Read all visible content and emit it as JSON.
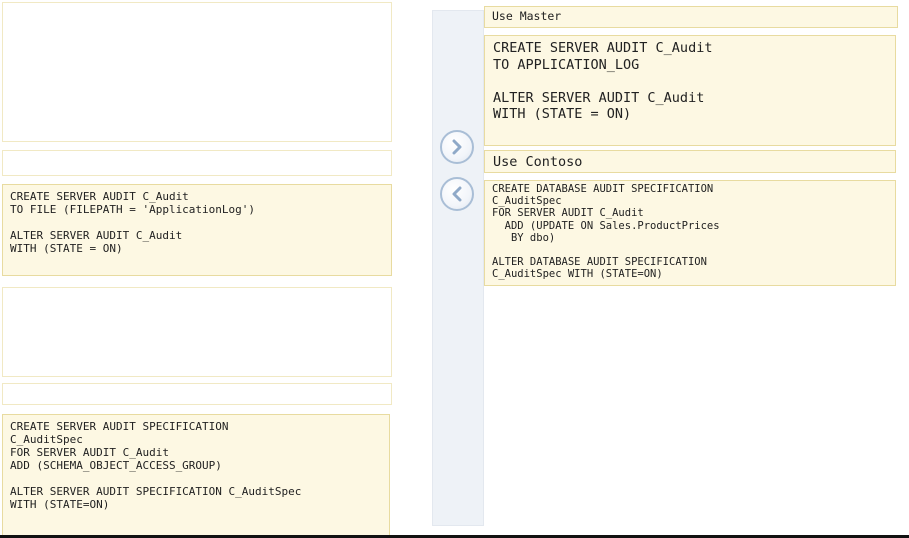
{
  "left": {
    "option_file": "CREATE SERVER AUDIT C_Audit\nTO FILE (FILEPATH = 'ApplicationLog')\n\nALTER SERVER AUDIT C_Audit\nWITH (STATE = ON)",
    "option_server_spec": "CREATE SERVER AUDIT SPECIFICATION\nC_AuditSpec\nFOR SERVER AUDIT C_Audit\nADD (SCHEMA_OBJECT_ACCESS_GROUP)\n\nALTER SERVER AUDIT SPECIFICATION C_AuditSpec\nWITH (STATE=ON)"
  },
  "controls": {
    "move_right_icon": "chevron-right-icon",
    "move_left_icon": "chevron-left-icon"
  },
  "right": {
    "use_master": "Use Master",
    "server_audit_app_log": "CREATE SERVER AUDIT C_Audit\nTO APPLICATION_LOG\n\nALTER SERVER AUDIT C_Audit\nWITH (STATE = ON)",
    "use_contoso": "Use Contoso",
    "database_spec": "CREATE DATABASE AUDIT SPECIFICATION\nC_AuditSpec\nFOR SERVER AUDIT C_Audit\n  ADD (UPDATE ON Sales.ProductPrices\n   BY dbo)\n\nALTER DATABASE AUDIT SPECIFICATION\nC_AuditSpec WITH (STATE=ON)"
  },
  "colors": {
    "box_fill": "#fdf8e3",
    "box_border": "#e8dba0",
    "panel": "#eef2f7",
    "button_ring": "#a9bed6"
  }
}
